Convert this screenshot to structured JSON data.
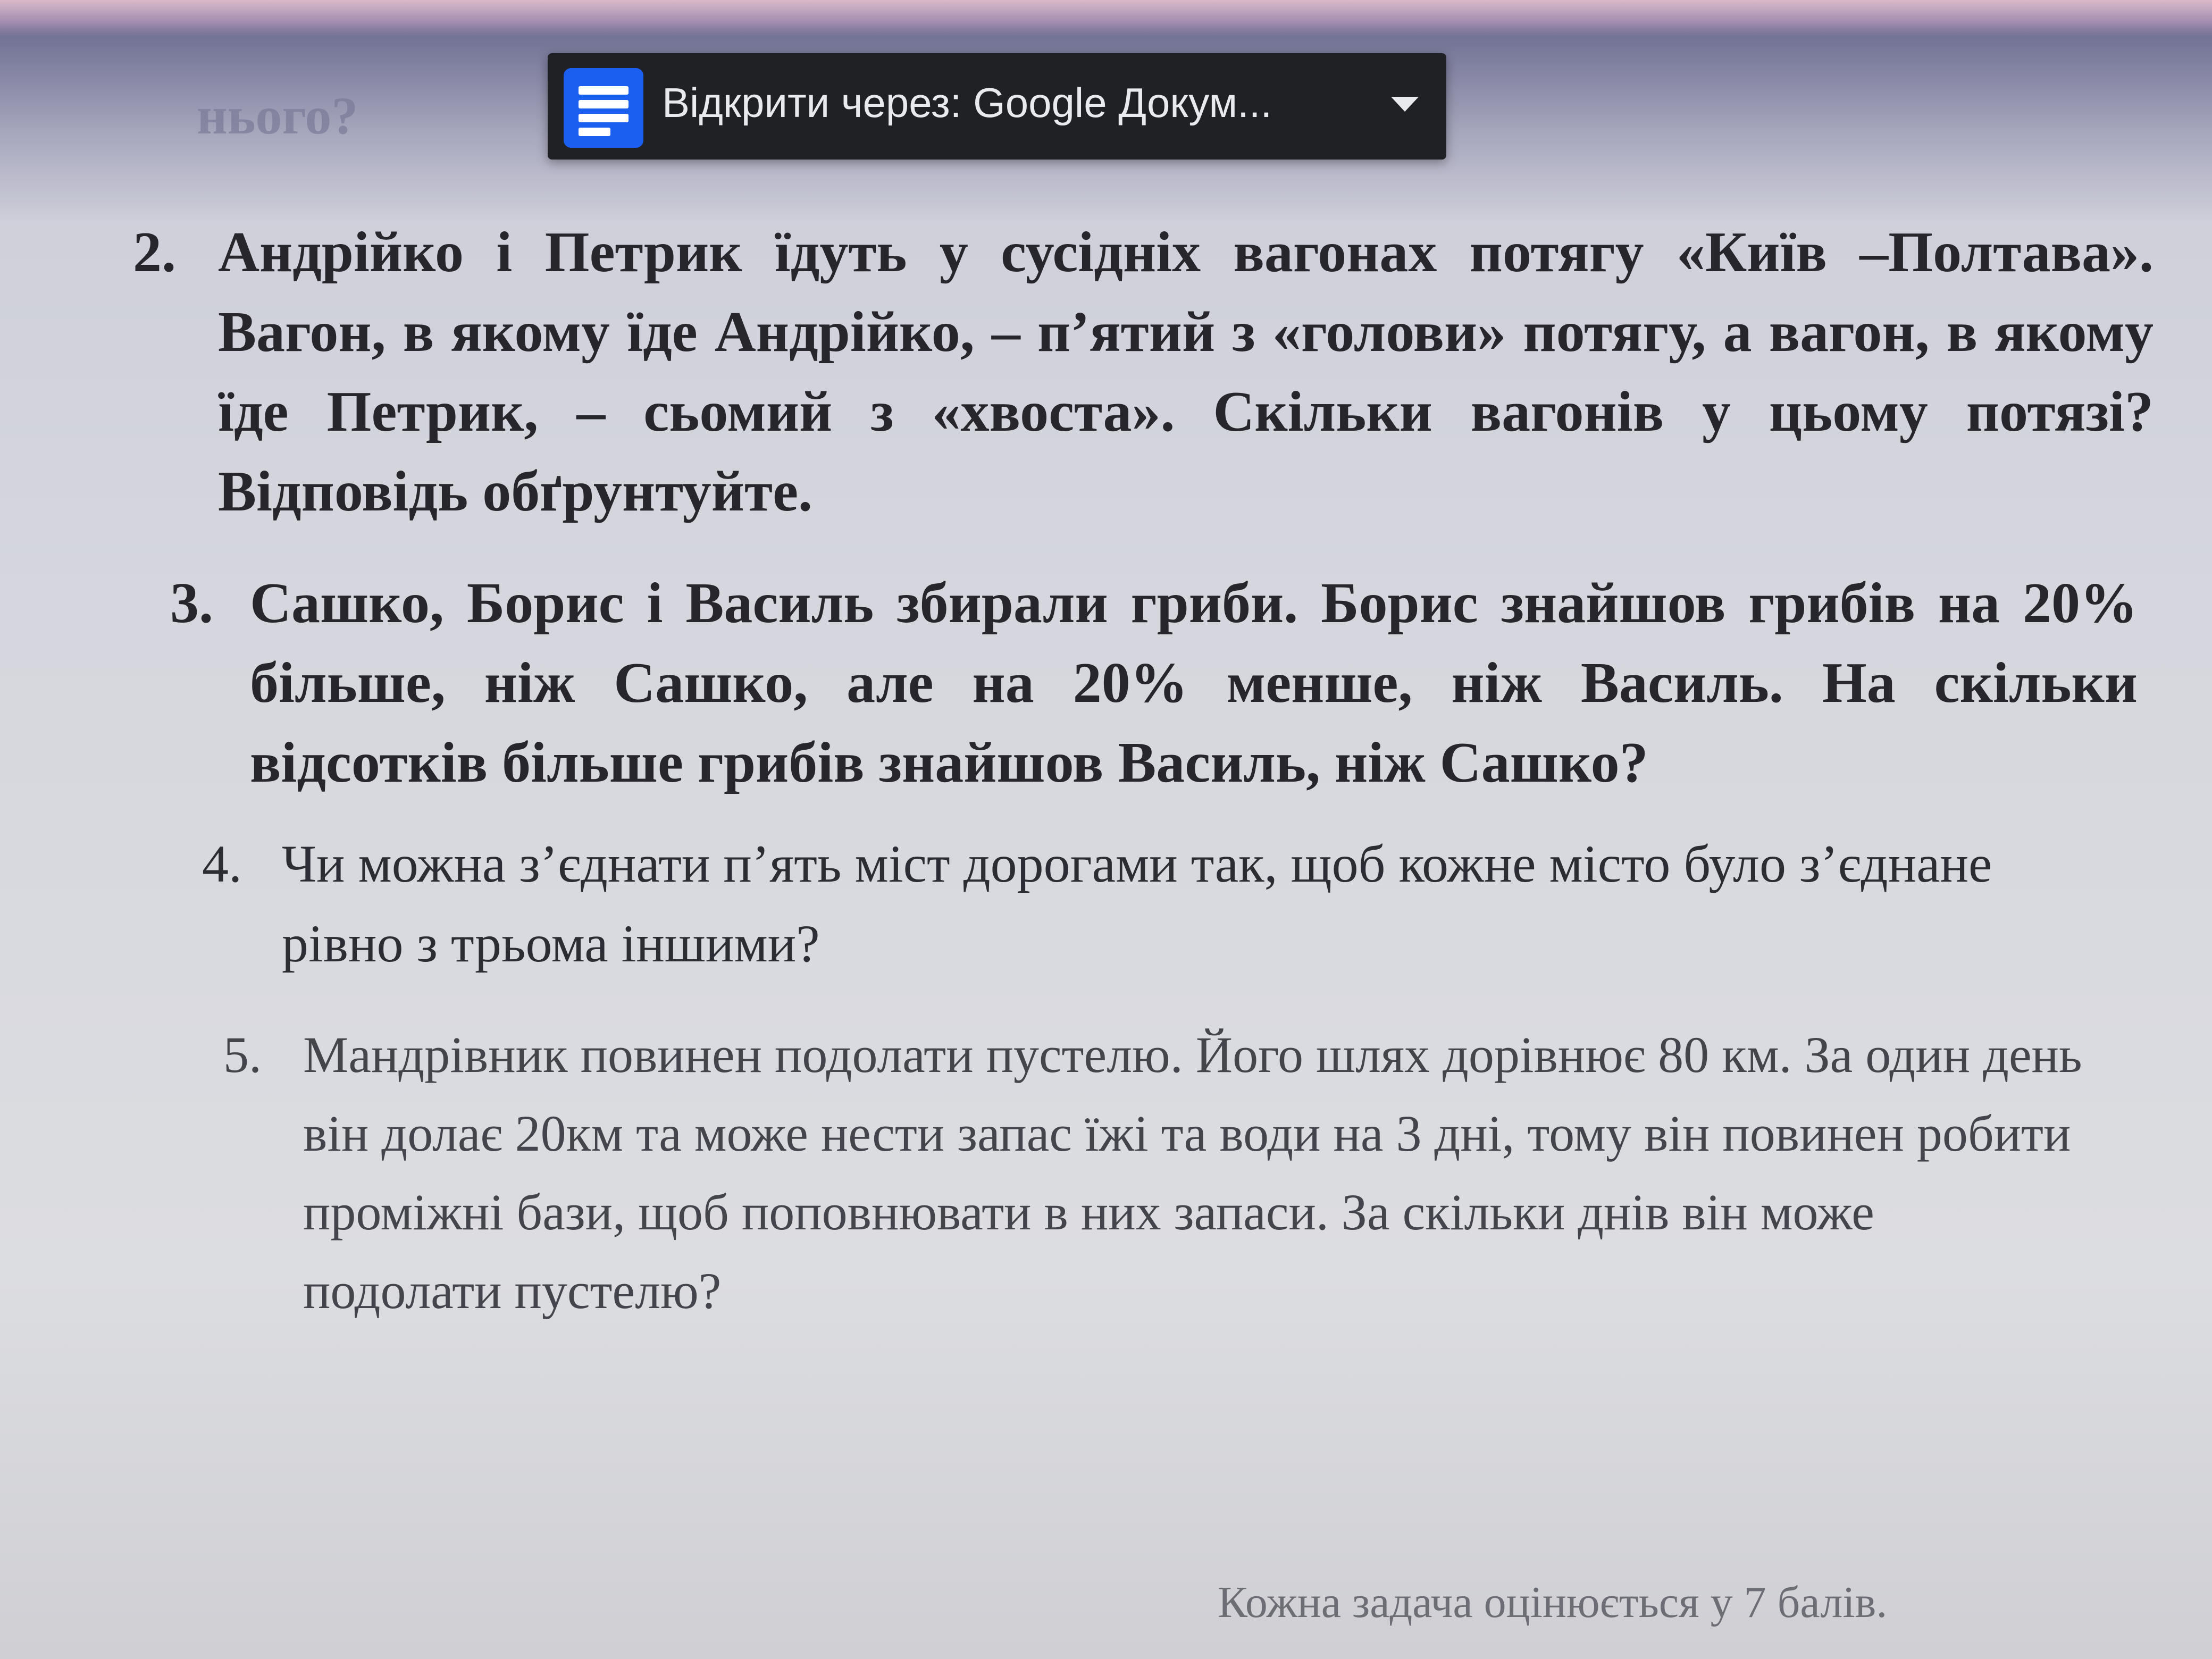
{
  "header": {
    "prev_fragment": "нього?"
  },
  "open_with": {
    "label": "Відкрити через: Google Докум...",
    "icon": "google-docs-icon",
    "arrow_icon": "dropdown-arrow-icon",
    "accent_color": "#1a5ff0",
    "bar_color": "#202124"
  },
  "problems": [
    {
      "number": "2.",
      "text": "Андрійко і Петрик їдуть у сусідніх вагонах потягу «Київ –Полтава». Вагон, в якому їде Андрійко, – п’ятий з «голови» потягу, а вагон, в якому їде Петрик, – сьомий з «хвоста». Скільки вагонів у цьому потязі? Відповідь обґрунтуйте."
    },
    {
      "number": "3.",
      "text": "Сашко, Борис і Василь збирали гриби. Борис знайшов грибів на 20% більше, ніж Сашко, але на 20% менше, ніж Василь. На скільки відсотків більше грибів знайшов Василь, ніж Сашко?"
    },
    {
      "number": "4.",
      "text": "Чи можна з’єднати п’ять міст дорогами так, щоб кожне місто було з’єднане рівно з трьома іншими?"
    },
    {
      "number": "5.",
      "text": "Мандрівник повинен подолати пустелю. Його шлях дорівнює 80 км. За один день він долає 20км та може нести запас їжі та води на 3 дні, тому він повинен робити проміжні бази, щоб поповнювати в них запаси. За скільки днів він може подолати пустелю?"
    }
  ],
  "footer": {
    "note": "Кожна задача оцінюється у 7 балів."
  }
}
